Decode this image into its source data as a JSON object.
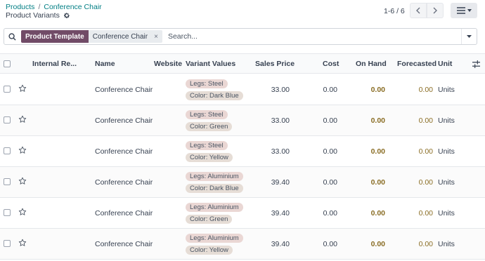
{
  "breadcrumb": {
    "parent": "Products",
    "separator": "/",
    "current": "Conference Chair"
  },
  "page": {
    "title": "Product Variants"
  },
  "pager": {
    "range": "1-6 / 6"
  },
  "search": {
    "facet_label": "Product Template",
    "facet_value": "Conference Chair",
    "facet_remove": "×",
    "placeholder": "Search..."
  },
  "columns": {
    "internal_ref": "Internal Re...",
    "name": "Name",
    "website": "Website",
    "variant_values": "Variant Values",
    "sales_price": "Sales Price",
    "cost": "Cost",
    "on_hand": "On Hand",
    "forecasted": "Forecasted",
    "unit": "Unit"
  },
  "rows": [
    {
      "name": "Conference Chair",
      "legs": "Legs: Steel",
      "color": "Color: Dark Blue",
      "price": "33.00",
      "cost": "0.00",
      "on_hand": "0.00",
      "forecasted": "0.00",
      "unit": "Units"
    },
    {
      "name": "Conference Chair",
      "legs": "Legs: Steel",
      "color": "Color: Green",
      "price": "33.00",
      "cost": "0.00",
      "on_hand": "0.00",
      "forecasted": "0.00",
      "unit": "Units"
    },
    {
      "name": "Conference Chair",
      "legs": "Legs: Steel",
      "color": "Color: Yellow",
      "price": "33.00",
      "cost": "0.00",
      "on_hand": "0.00",
      "forecasted": "0.00",
      "unit": "Units"
    },
    {
      "name": "Conference Chair",
      "legs": "Legs: Aluminium",
      "color": "Color: Dark Blue",
      "price": "39.40",
      "cost": "0.00",
      "on_hand": "0.00",
      "forecasted": "0.00",
      "unit": "Units"
    },
    {
      "name": "Conference Chair",
      "legs": "Legs: Aluminium",
      "color": "Color: Green",
      "price": "39.40",
      "cost": "0.00",
      "on_hand": "0.00",
      "forecasted": "0.00",
      "unit": "Units"
    },
    {
      "name": "Conference Chair",
      "legs": "Legs: Aluminium",
      "color": "Color: Yellow",
      "price": "39.40",
      "cost": "0.00",
      "on_hand": "0.00",
      "forecasted": "0.00",
      "unit": "Units"
    }
  ],
  "colors": {
    "accent": "#017e84",
    "facet": "#714b67",
    "quantity": "#8a6d24"
  }
}
